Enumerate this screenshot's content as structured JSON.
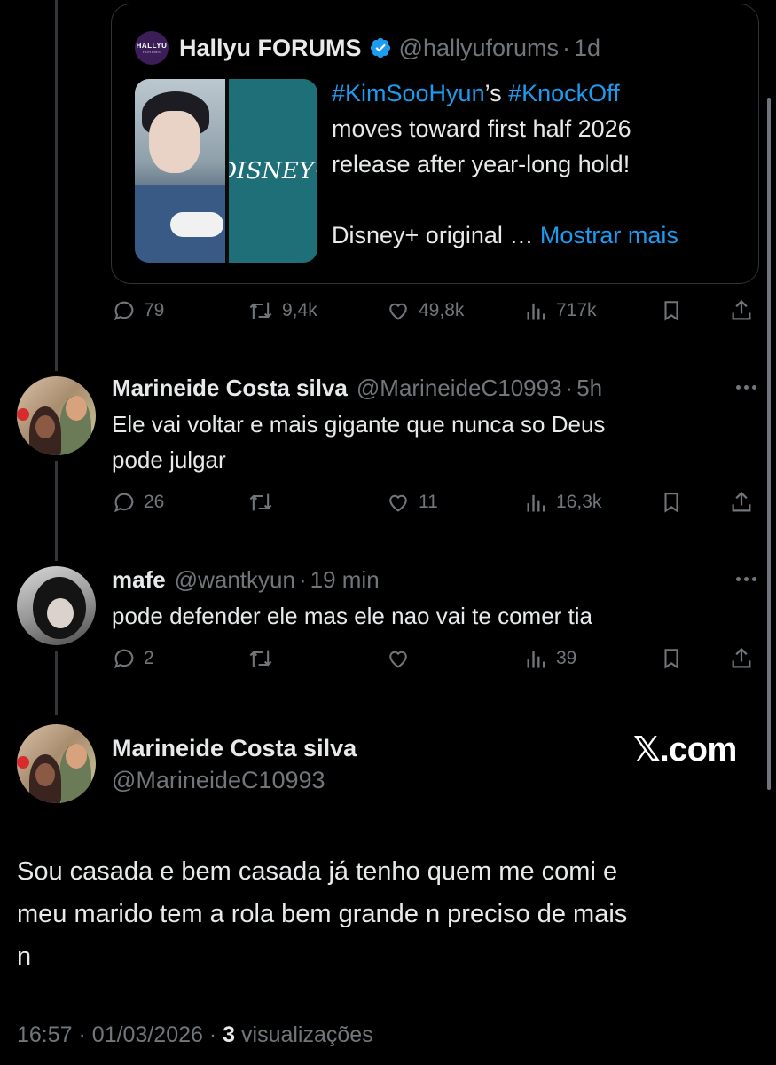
{
  "quoted": {
    "logo_line1": "HALLYU",
    "logo_line2": "FORUMS",
    "name": "Hallyu FORUMS",
    "handle": "@hallyuforums",
    "time": "1d",
    "image_text": "DISNEY+",
    "hashtag1": "#KimSooHyun",
    "possessive": "’s",
    "hashtag2": "#KnockOff",
    "text_line2": "moves toward first half 2026",
    "text_line3": "release after year-long hold!",
    "text_line4": "Disney+ original …",
    "show_more": "Mostrar mais",
    "stats": {
      "replies": "79",
      "reposts": "9,4k",
      "likes": "49,8k",
      "views": "717k"
    }
  },
  "replies": [
    {
      "name": "Marineide Costa silva",
      "handle": "@MarineideC10993",
      "time": "5h",
      "text_line1": "Ele vai voltar e mais gigante  que nunca  so Deus",
      "text_line2": "pode julgar",
      "stats": {
        "replies": "26",
        "reposts": "",
        "likes": "11",
        "views": "16,3k"
      }
    },
    {
      "name": "mafe",
      "handle": "@wantkyun",
      "time": "19 min",
      "text_line1": "pode defender ele mas ele nao vai te comer tia",
      "stats": {
        "replies": "2",
        "reposts": "",
        "likes": "",
        "views": "39"
      }
    }
  ],
  "main": {
    "name": "Marineide Costa silva",
    "handle": "@MarineideC10993",
    "watermark": "𝕏.com",
    "text_line1": "Sou casada  e bem casada já tenho quem me comi e",
    "text_line2": "meu marido  tem a rola bem grande n preciso  de mais",
    "text_line3": "n",
    "time": "16:57",
    "date": "01/03/2026",
    "views_count": "3",
    "views_label": "visualizações"
  },
  "colors": {
    "background": "#000000",
    "text": "#e7e9ea",
    "muted": "#71767b",
    "link": "#1d9bf0",
    "verified": "#1d9bf0",
    "border": "#2f3336"
  }
}
